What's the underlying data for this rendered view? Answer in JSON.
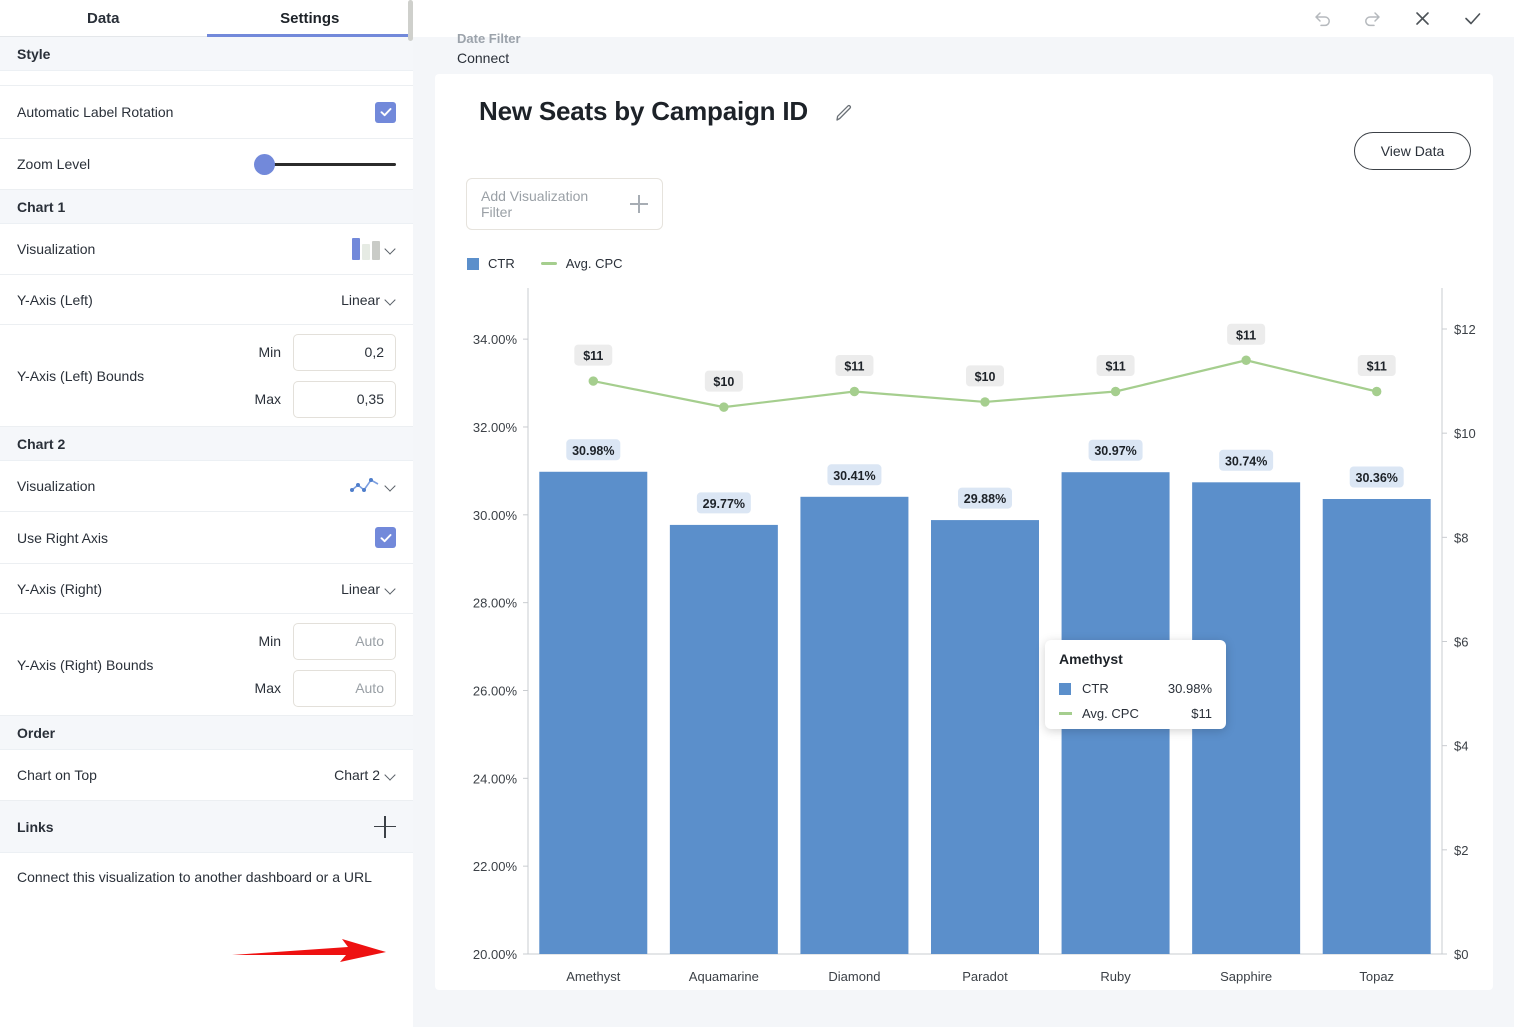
{
  "tabs": [
    {
      "label": "Data",
      "active": false
    },
    {
      "label": "Settings",
      "active": true
    }
  ],
  "toolbar": {
    "undo": "undo-icon",
    "redo": "redo-icon",
    "close": "close-icon",
    "apply": "check-icon"
  },
  "sidebar": {
    "sections": [
      {
        "title": "Style"
      },
      {
        "title": "Chart 1"
      },
      {
        "title": "Chart 2"
      },
      {
        "title": "Order"
      },
      {
        "title": "Links"
      }
    ],
    "automatic_label_rotation": {
      "label": "Automatic Label Rotation",
      "checked": true
    },
    "zoom_level": {
      "label": "Zoom Level",
      "value": 0
    },
    "chart1_visualization": {
      "label": "Visualization",
      "icon": "bar-chart-icon"
    },
    "y_axis_left": {
      "label": "Y-Axis (Left)",
      "value": "Linear"
    },
    "y_axis_left_bounds": {
      "label": "Y-Axis (Left) Bounds",
      "min_label": "Min",
      "min_value": "0,2",
      "min_placeholder": "Auto",
      "max_label": "Max",
      "max_value": "0,35",
      "max_placeholder": "Auto"
    },
    "chart2_visualization": {
      "label": "Visualization",
      "icon": "line-chart-icon"
    },
    "use_right_axis": {
      "label": "Use Right Axis",
      "checked": true
    },
    "y_axis_right": {
      "label": "Y-Axis (Right)",
      "value": "Linear"
    },
    "y_axis_right_bounds": {
      "label": "Y-Axis (Right) Bounds",
      "min_label": "Min",
      "min_value": "",
      "min_placeholder": "Auto",
      "max_label": "Max",
      "max_value": "",
      "max_placeholder": "Auto"
    },
    "chart_on_top": {
      "label": "Chart on Top",
      "value": "Chart 2"
    },
    "links": {
      "label": "Links",
      "add": "plus-icon"
    },
    "links_helper": "Connect this visualization to another dashboard or a URL"
  },
  "date_filter": {
    "label": "Date Filter",
    "value": "Connect"
  },
  "visualization": {
    "title": "New Seats by Campaign ID",
    "edit_icon": "pencil-icon",
    "filter_placeholder": "Add Visualization Filter",
    "view_data_label": "View Data"
  },
  "tooltip": {
    "title": "Amethyst",
    "rows": [
      {
        "name": "CTR",
        "value": "30.98%",
        "marker": "square"
      },
      {
        "name": "Avg. CPC",
        "value": "$11",
        "marker": "line"
      }
    ]
  },
  "colors": {
    "bar": "#5b8fcb",
    "line": "#a5ce8e",
    "accent": "#7289da",
    "bar_label_bg": "#dbe6f4",
    "line_label_bg": "#ececec"
  },
  "chart_data": {
    "type": "bar",
    "title": "New Seats by Campaign ID",
    "xlabel": "",
    "ylabel": "",
    "grid": false,
    "legend_position": "top-left",
    "categories": [
      "Amethyst",
      "Aquamarine",
      "Diamond",
      "Paradot",
      "Ruby",
      "Sapphire",
      "Topaz"
    ],
    "series": [
      {
        "name": "CTR",
        "type": "bar",
        "axis": "left",
        "color": "#5b8fcb",
        "values": [
          30.98,
          29.77,
          30.41,
          29.88,
          30.97,
          30.74,
          30.36
        ],
        "labels": [
          "30.98%",
          "29.77%",
          "30.41%",
          "29.88%",
          "30.97%",
          "30.74%",
          "30.36%"
        ]
      },
      {
        "name": "Avg. CPC",
        "type": "line",
        "axis": "right",
        "color": "#a5ce8e",
        "values": [
          11.0,
          10.5,
          10.8,
          10.6,
          10.8,
          11.4,
          10.8
        ],
        "labels": [
          "$11",
          "$10",
          "$11",
          "$10",
          "$11",
          "$11",
          "$11"
        ]
      }
    ],
    "y_left": {
      "min": 20.0,
      "max": 34.8,
      "ticks": [
        "20.00%",
        "22.00%",
        "24.00%",
        "26.00%",
        "28.00%",
        "30.00%",
        "32.00%",
        "34.00%"
      ],
      "tick_values": [
        20,
        22,
        24,
        26,
        28,
        30,
        32,
        34
      ]
    },
    "y_right": {
      "min": 0,
      "max": 12.48,
      "ticks": [
        "$0",
        "$2",
        "$4",
        "$6",
        "$8",
        "$10",
        "$12"
      ],
      "tick_values": [
        0,
        2,
        4,
        6,
        8,
        10,
        12
      ]
    }
  }
}
